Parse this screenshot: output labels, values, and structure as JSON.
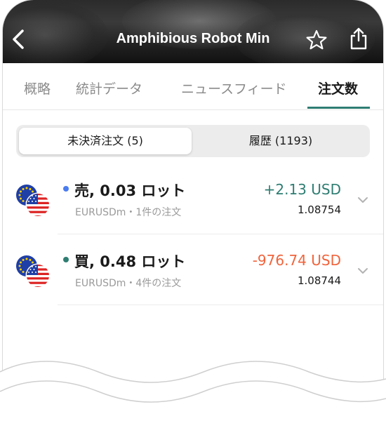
{
  "header": {
    "title": "Amphibious Robot Min",
    "back_icon": "chevron-left-icon",
    "star_icon": "star-outline-icon",
    "share_icon": "share-icon"
  },
  "tabs": [
    {
      "label": "概略",
      "active": false
    },
    {
      "label": "統計データ",
      "active": false
    },
    {
      "label": "ニュースフィード",
      "active": false
    },
    {
      "label": "注文数",
      "active": true
    }
  ],
  "segment": {
    "open_label": "未決済注文 (5)",
    "history_label": "履歴 (1193)",
    "selected": "open"
  },
  "orders": [
    {
      "side": "売, 0.03 ロット",
      "side_color": "#4a7cf0",
      "meta": "EURUSDm・1件の注文",
      "pl": "+2.13 USD",
      "pl_color": "#2e7d72",
      "price": "1.08754"
    },
    {
      "side": "買, 0.48 ロット",
      "side_color": "#2e7d72",
      "meta": "EURUSDm・4件の注文",
      "pl": "-976.74 USD",
      "pl_color": "#f0643c",
      "price": "1.08744"
    }
  ],
  "colors": {
    "accent": "#2e7d72",
    "profit": "#2e7d72",
    "loss": "#f0643c"
  }
}
